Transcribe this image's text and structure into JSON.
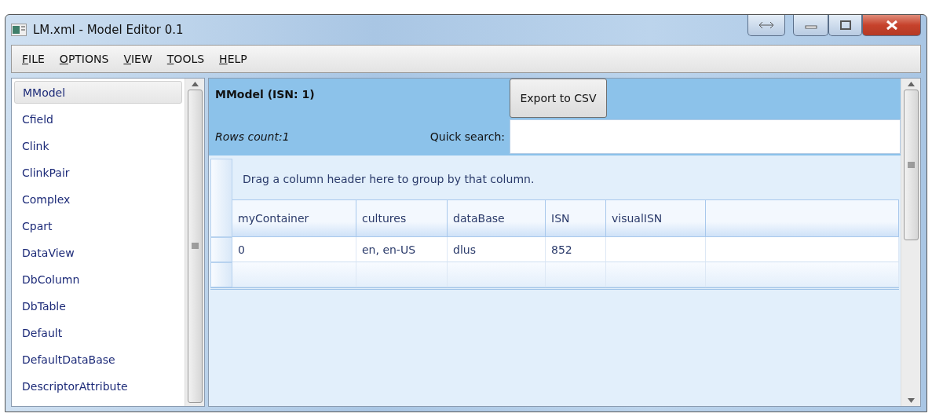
{
  "window": {
    "title": "LM.xml - Model Editor 0.1"
  },
  "menu": [
    "FILE",
    "OPTIONS",
    "VIEW",
    "TOOLS",
    "HELP"
  ],
  "sidebar": {
    "items": [
      {
        "label": "MModel",
        "selected": true
      },
      {
        "label": "Cfield",
        "selected": false
      },
      {
        "label": "Clink",
        "selected": false
      },
      {
        "label": "ClinkPair",
        "selected": false
      },
      {
        "label": "Complex",
        "selected": false
      },
      {
        "label": "Cpart",
        "selected": false
      },
      {
        "label": "DataView",
        "selected": false
      },
      {
        "label": "DbColumn",
        "selected": false
      },
      {
        "label": "DbTable",
        "selected": false
      },
      {
        "label": "Default",
        "selected": false
      },
      {
        "label": "DefaultDataBase",
        "selected": false
      },
      {
        "label": "DescriptorAttribute",
        "selected": false
      }
    ]
  },
  "panel": {
    "title": "MModel (ISN: 1)",
    "export_button": "Export to CSV",
    "rows_count": "Rows count:1",
    "search_label": "Quick search:"
  },
  "grid": {
    "group_hint": "Drag a column header here to group by that column.",
    "columns": [
      "myContainer",
      "cultures",
      "dataBase",
      "ISN",
      "visualISN"
    ],
    "rows": [
      [
        "0",
        "en, en-US",
        "dlus",
        "852",
        ""
      ]
    ]
  }
}
